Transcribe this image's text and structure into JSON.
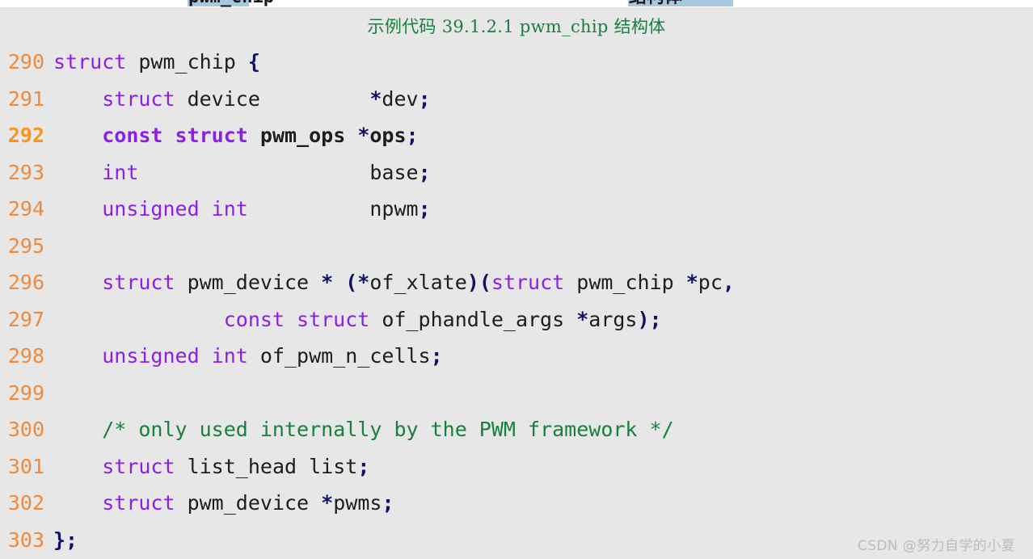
{
  "caption": "示例代码 39.1.2.1 pwm_chip 结构体",
  "watermark": "CSDN @努力自学的小夏",
  "colors": {
    "panel_background": "#e7e7e7",
    "page_background": "#ffffff",
    "line_number": "#ef8a3c",
    "line_number_bold": "#f7941e",
    "keyword": "#8b1ee8",
    "punctuation": "#111166",
    "identifier": "#1d1d21",
    "comment": "#17803d",
    "caption_text": "#17803d",
    "watermark_text": "#bdbdbd",
    "selection_highlight": "#a8c8e0"
  },
  "top_fragments": [
    {
      "text": "pwm_chip",
      "highlight": true
    },
    {
      "text": "结构体",
      "highlight": true
    }
  ],
  "code": {
    "language": "c",
    "first_line": 290,
    "last_line": 303,
    "lines": [
      {
        "number": "290",
        "bold": false,
        "text": "struct pwm_chip {",
        "tokens": [
          {
            "t": "struct",
            "c": "kw"
          },
          {
            "t": " pwm_chip ",
            "c": "id"
          },
          {
            "t": "{",
            "c": "pct"
          }
        ]
      },
      {
        "number": "291",
        "bold": false,
        "text": "    struct device         *dev;",
        "tokens": [
          {
            "t": "    ",
            "c": "id"
          },
          {
            "t": "struct",
            "c": "kw"
          },
          {
            "t": " device         ",
            "c": "id"
          },
          {
            "t": "*",
            "c": "pct"
          },
          {
            "t": "dev",
            "c": "id"
          },
          {
            "t": ";",
            "c": "pct"
          }
        ]
      },
      {
        "number": "292",
        "bold": true,
        "text": "    const struct pwm_ops *ops;",
        "tokens": [
          {
            "t": "    ",
            "c": "id"
          },
          {
            "t": "const struct",
            "c": "kw"
          },
          {
            "t": " pwm_ops ",
            "c": "id"
          },
          {
            "t": "*",
            "c": "pct"
          },
          {
            "t": "ops",
            "c": "id"
          },
          {
            "t": ";",
            "c": "pct"
          }
        ]
      },
      {
        "number": "293",
        "bold": false,
        "text": "    int                   base;",
        "tokens": [
          {
            "t": "    ",
            "c": "id"
          },
          {
            "t": "int",
            "c": "kw"
          },
          {
            "t": "                   base",
            "c": "id"
          },
          {
            "t": ";",
            "c": "pct"
          }
        ]
      },
      {
        "number": "294",
        "bold": false,
        "text": "    unsigned int          npwm;",
        "tokens": [
          {
            "t": "    ",
            "c": "id"
          },
          {
            "t": "unsigned int",
            "c": "kw"
          },
          {
            "t": "          npwm",
            "c": "id"
          },
          {
            "t": ";",
            "c": "pct"
          }
        ]
      },
      {
        "number": "295",
        "bold": false,
        "text": "",
        "tokens": []
      },
      {
        "number": "296",
        "bold": false,
        "text": "    struct pwm_device * (*of_xlate)(struct pwm_chip *pc,",
        "tokens": [
          {
            "t": "    ",
            "c": "id"
          },
          {
            "t": "struct",
            "c": "kw"
          },
          {
            "t": " pwm_device ",
            "c": "id"
          },
          {
            "t": "* (*",
            "c": "pct"
          },
          {
            "t": "of_xlate",
            "c": "id"
          },
          {
            "t": ")(",
            "c": "pct"
          },
          {
            "t": "struct",
            "c": "kw"
          },
          {
            "t": " pwm_chip ",
            "c": "id"
          },
          {
            "t": "*",
            "c": "pct"
          },
          {
            "t": "pc",
            "c": "id"
          },
          {
            "t": ",",
            "c": "pct"
          }
        ]
      },
      {
        "number": "297",
        "bold": false,
        "text": "              const struct of_phandle_args *args);",
        "tokens": [
          {
            "t": "              ",
            "c": "id"
          },
          {
            "t": "const struct",
            "c": "kw"
          },
          {
            "t": " of_phandle_args ",
            "c": "id"
          },
          {
            "t": "*",
            "c": "pct"
          },
          {
            "t": "args",
            "c": "id"
          },
          {
            "t": ");",
            "c": "pct"
          }
        ]
      },
      {
        "number": "298",
        "bold": false,
        "text": "    unsigned int of_pwm_n_cells;",
        "tokens": [
          {
            "t": "    ",
            "c": "id"
          },
          {
            "t": "unsigned int",
            "c": "kw"
          },
          {
            "t": " of_pwm_n_cells",
            "c": "id"
          },
          {
            "t": ";",
            "c": "pct"
          }
        ]
      },
      {
        "number": "299",
        "bold": false,
        "text": "",
        "tokens": []
      },
      {
        "number": "300",
        "bold": false,
        "text": "    /* only used internally by the PWM framework */",
        "tokens": [
          {
            "t": "    ",
            "c": "id"
          },
          {
            "t": "/* only used internally by the PWM framework */",
            "c": "cmt"
          }
        ]
      },
      {
        "number": "301",
        "bold": false,
        "text": "    struct list_head list;",
        "tokens": [
          {
            "t": "    ",
            "c": "id"
          },
          {
            "t": "struct",
            "c": "kw"
          },
          {
            "t": " list_head list",
            "c": "id"
          },
          {
            "t": ";",
            "c": "pct"
          }
        ]
      },
      {
        "number": "302",
        "bold": false,
        "text": "    struct pwm_device *pwms;",
        "tokens": [
          {
            "t": "    ",
            "c": "id"
          },
          {
            "t": "struct",
            "c": "kw"
          },
          {
            "t": " pwm_device ",
            "c": "id"
          },
          {
            "t": "*",
            "c": "pct"
          },
          {
            "t": "pwms",
            "c": "id"
          },
          {
            "t": ";",
            "c": "pct"
          }
        ]
      },
      {
        "number": "303",
        "bold": false,
        "text": "};",
        "tokens": [
          {
            "t": "};",
            "c": "pct"
          }
        ]
      }
    ]
  }
}
